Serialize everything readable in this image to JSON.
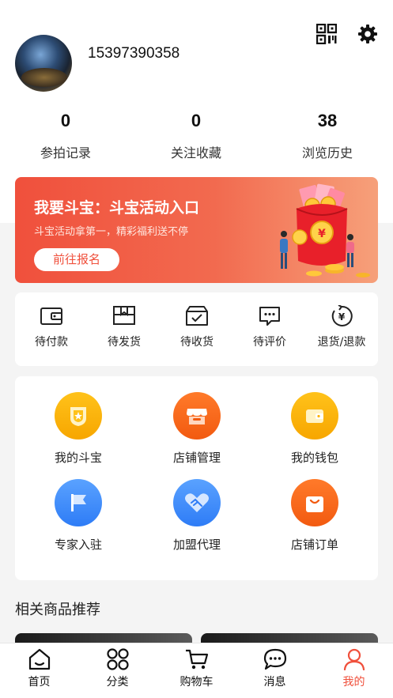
{
  "profile": {
    "phone": "15397390358"
  },
  "stats": [
    {
      "value": "0",
      "label": "参拍记录"
    },
    {
      "value": "0",
      "label": "关注收藏"
    },
    {
      "value": "38",
      "label": "浏览历史"
    }
  ],
  "banner": {
    "title": "我要斗宝：斗宝活动入口",
    "subtitle": "斗宝活动拿第一，精彩福利送不停",
    "button": "前往报名"
  },
  "orders": [
    {
      "label": "待付款",
      "icon": "wallet-icon"
    },
    {
      "label": "待发货",
      "icon": "box-icon"
    },
    {
      "label": "待收货",
      "icon": "delivery-box-icon"
    },
    {
      "label": "待评价",
      "icon": "comment-icon"
    },
    {
      "label": "退货/退款",
      "icon": "refund-icon"
    }
  ],
  "services": [
    {
      "label": "我的斗宝",
      "icon": "badge-icon"
    },
    {
      "label": "店铺管理",
      "icon": "shop-icon"
    },
    {
      "label": "我的钱包",
      "icon": "wallet-icon"
    },
    {
      "label": "专家入驻",
      "icon": "flag-icon"
    },
    {
      "label": "加盟代理",
      "icon": "handshake-icon"
    },
    {
      "label": "店铺订单",
      "icon": "shopping-bag-icon"
    }
  ],
  "recommend": {
    "title": "相关商品推荐"
  },
  "tabbar": [
    {
      "label": "首页",
      "icon": "home-icon"
    },
    {
      "label": "分类",
      "icon": "category-icon"
    },
    {
      "label": "购物车",
      "icon": "cart-icon"
    },
    {
      "label": "消息",
      "icon": "message-icon"
    },
    {
      "label": "我的",
      "icon": "profile-icon",
      "active": true
    }
  ],
  "colors": {
    "accent": "#f0503c",
    "yellow": "#ffb400",
    "orange": "#f5621a",
    "blue": "#3d8bfa"
  }
}
